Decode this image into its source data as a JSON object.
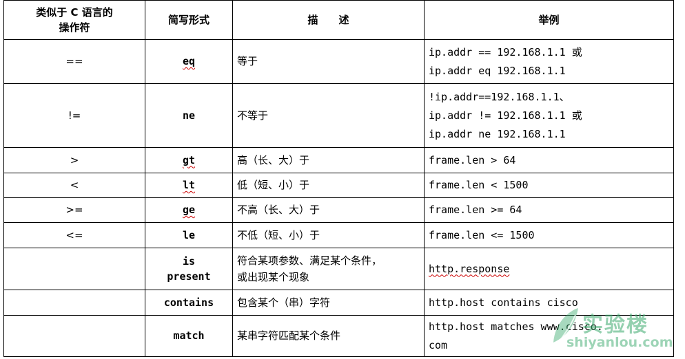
{
  "header": {
    "col1_line1": "类似于 C 语言的",
    "col1_line2": "操作符",
    "col2": "简写形式",
    "col3": "描　　述",
    "col4": "举例"
  },
  "rows": [
    {
      "op": "==",
      "abbr": "eq",
      "desc": "等于",
      "examples": [
        "ip.addr == 192.168.1.1 或",
        "ip.addr eq 192.168.1.1"
      ]
    },
    {
      "op": "!=",
      "abbr": "ne",
      "desc": "不等于",
      "examples": [
        "!ip.addr==192.168.1.1、",
        "ip.addr != 192.168.1.1 或",
        "ip.addr ne 192.168.1.1"
      ]
    },
    {
      "op": ">",
      "abbr": "gt",
      "desc": "高（长、大）于",
      "examples": [
        "frame.len > 64"
      ]
    },
    {
      "op": "<",
      "abbr": "lt",
      "desc": "低（短、小）于",
      "examples": [
        "frame.len < 1500"
      ]
    },
    {
      "op": ">=",
      "abbr": "ge",
      "desc": "不高（长、大）于",
      "examples": [
        "frame.len >= 64"
      ]
    },
    {
      "op": "<=",
      "abbr": "le",
      "desc": "不低（短、小）于",
      "examples": [
        "frame.len <= 1500"
      ]
    },
    {
      "op": "",
      "abbr_line1": "is",
      "abbr_line2": "present",
      "desc_line1": "符合某项参数、满足某个条件，",
      "desc_line2": "或出现某个现象",
      "examples": [
        "http.response"
      ]
    },
    {
      "op": "",
      "abbr": "contains",
      "desc": "包含某个（串）字符",
      "examples": [
        "http.host contains cisco"
      ]
    },
    {
      "op": "",
      "abbr": "match",
      "desc": "某串字符匹配某个条件",
      "examples": [
        "http.host matches www.cisco.",
        "com"
      ]
    }
  ],
  "watermark": {
    "text": "实验楼",
    "sub": "shiyanlou.com",
    "color": "#3caa6e"
  }
}
